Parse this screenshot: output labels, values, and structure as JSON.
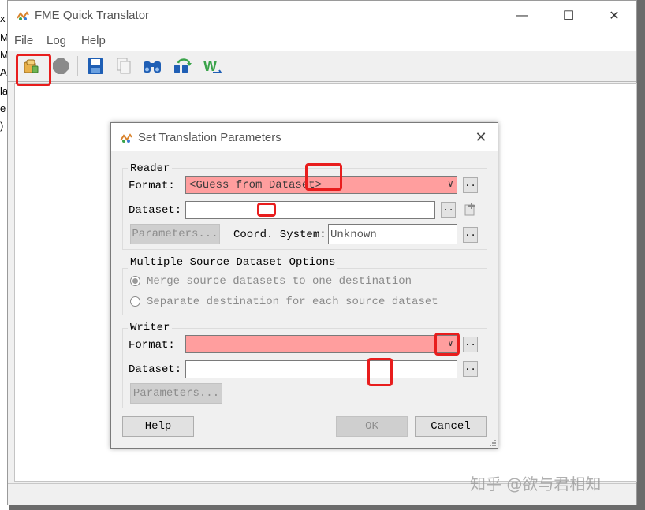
{
  "background": {
    "fragments": [
      "x",
      "M",
      "M",
      "A",
      "la",
      "e",
      ")"
    ]
  },
  "window": {
    "title": "FME Quick Translator",
    "controls": {
      "minimize": "—",
      "maximize": "☐",
      "close": "✕"
    }
  },
  "menu": {
    "items": [
      "File",
      "Log",
      "Help"
    ]
  },
  "toolbar": {
    "buttons": [
      "translate-icon",
      "stop-icon",
      "save-icon",
      "copy-icon",
      "find-icon",
      "find-next-icon",
      "workbench-icon"
    ]
  },
  "dialog": {
    "title": "Set Translation Parameters",
    "close": "✕",
    "reader": {
      "group_label": "Reader",
      "format_label": "Format:",
      "format_value": "<Guess from Dataset>",
      "dataset_label": "Dataset:",
      "dataset_value": "",
      "parameters_label": "Parameters...",
      "coord_label": "Coord. System:",
      "coord_value": "Unknown",
      "browse_label": ".."
    },
    "multi": {
      "group_label": "Multiple Source Dataset Options",
      "option_merge": "Merge source datasets to one destination",
      "option_separate": "Separate destination for each source dataset",
      "selected": "merge"
    },
    "writer": {
      "group_label": "Writer",
      "format_label": "Format:",
      "format_value": "",
      "dataset_label": "Dataset:",
      "dataset_value": "",
      "parameters_label": "Parameters...",
      "browse_label": ".."
    },
    "buttons": {
      "help": "Help",
      "ok": "OK",
      "cancel": "Cancel"
    }
  },
  "watermark": "知乎 @欲与君相知",
  "colors": {
    "highlight": "#e81d1d",
    "format_bg": "#ff9e9e"
  }
}
